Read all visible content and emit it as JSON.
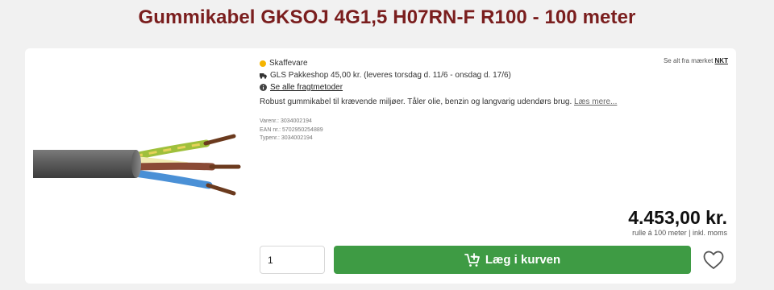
{
  "product": {
    "title": "Gummikabel GKSOJ 4G1,5 H07RN-F R100 - 100 meter",
    "stock_status": "Skaffevare",
    "shipping_info": "GLS Pakkeshop 45,00 kr. (leveres torsdag d. 11/6 - onsdag d. 17/6)",
    "shipping_link": "Se alle fragtmetoder",
    "brand_prefix": "Se alt fra mærket",
    "brand_name": "NKT",
    "description": "Robust gummikabel til krævende miljøer. Tåler olie, benzin og langvarig udendørs brug.",
    "read_more": "Læs mere...",
    "varenr": "Varenr.: 3034002194",
    "ean": "EAN nr.: 5702950254889",
    "typenr": "Typenr.: 3034002194",
    "price": "4.453,00 kr.",
    "price_sub": "rulle á 100 meter | inkl. moms",
    "quantity": "1",
    "add_to_cart": "Læg i kurven"
  },
  "icons": {
    "stock": "status-dot-icon",
    "truck": "truck-icon",
    "info": "info-icon",
    "cart": "cart-plus-icon",
    "favorite": "heart-icon"
  },
  "colors": {
    "title": "#7a1e1e",
    "stock_dot": "#f5b400",
    "cart_button": "#3e9b44"
  }
}
